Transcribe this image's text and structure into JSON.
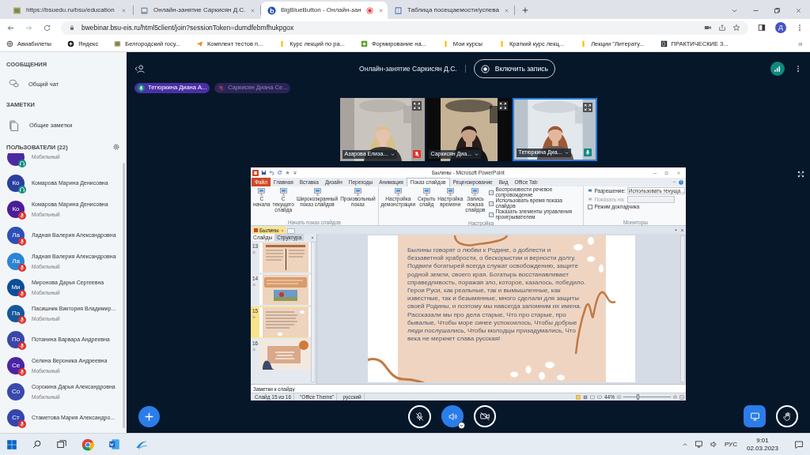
{
  "browser": {
    "tabs": [
      {
        "title": "https://bsuedu.ru/bsu/education",
        "kind": "site",
        "selected": false,
        "recording": false
      },
      {
        "title": "Онлайн-занятие Саркисян Д.С.",
        "kind": "page",
        "selected": false,
        "recording": false
      },
      {
        "title": "BigBlueButton - Онлайн-зан",
        "kind": "conference",
        "selected": true,
        "recording": true
      },
      {
        "title": "Таблица посещаемости/успева",
        "kind": "sheet",
        "selected": false,
        "recording": false
      }
    ],
    "url": "bwebinar.bsu-eis.ru/html5client/join?sessionToken=dumdfebmfhukpgox",
    "profile": "Д",
    "bookmarks": [
      {
        "label": "Авиабилеты",
        "kind": "globe"
      },
      {
        "label": "Яндекс",
        "kind": "circle"
      },
      {
        "label": "Белгородский госу...",
        "kind": "site"
      },
      {
        "label": "Комплект тестов п...",
        "kind": "plane"
      },
      {
        "label": "Курс лекций по ра...",
        "kind": "bar"
      },
      {
        "label": "Формирование на...",
        "kind": "green"
      },
      {
        "label": "Мои курсы",
        "kind": "bar"
      },
      {
        "label": "Краткий курс лекц...",
        "kind": "bar"
      },
      {
        "label": "Лекции \"Литерату...",
        "kind": "bar"
      },
      {
        "label": "ПРАКТИЧЕСКИЕ З...",
        "kind": "dark"
      }
    ]
  },
  "sidebar": {
    "messages_heading": "СООБЩЕНИЯ",
    "chat": "Общий чат",
    "notes_heading": "ЗАМЕТКИ",
    "notes": "Общие заметки",
    "users_heading": "ПОЛЬЗОВАТЕЛИ (22)",
    "users": [
      {
        "subtitle": "Мобильный",
        "color": "#4b2aa0",
        "kind": "listener"
      },
      {
        "initials": "Ко",
        "name": "Комарова Марина Денисовна",
        "color": "#2a3f9f",
        "kind": "listener"
      },
      {
        "initials": "Ко",
        "name": "Комарова Марина Денисовна",
        "subtitle": "Мобильный",
        "color": "#4a1e98",
        "kind": "muted"
      },
      {
        "initials": "Ла",
        "name": "Ладная Валерия Александровна",
        "color": "#2d4fb8",
        "kind": "muted"
      },
      {
        "initials": "Ла",
        "name": "Ладная Валерия Александровна",
        "subtitle": "Мобильный",
        "color": "#2b84d6",
        "kind": "muted"
      },
      {
        "initials": "Ми",
        "name": "Миронова Дарья Сергеевна",
        "subtitle": "Мобильный",
        "color": "#0d4d99",
        "kind": "muted"
      },
      {
        "initials": "Па",
        "name": "Пасишник Виктория Владимир...",
        "subtitle": "Мобильный",
        "color": "#15579c",
        "kind": "muted"
      },
      {
        "initials": "По",
        "name": "Потанина Варвара Андреевна",
        "color": "#3a46a8",
        "kind": "muted"
      },
      {
        "initials": "Се",
        "name": "Селина Вероника Андреевна",
        "subtitle": "Мобильный",
        "color": "#4a24a4",
        "kind": "muted"
      },
      {
        "initials": "Со",
        "name": "Сорокина Дарья Александровна",
        "subtitle": "Мобильный",
        "color": "#3949ab",
        "kind": "plain"
      },
      {
        "initials": "Ст",
        "name": "Стаметова Мария Александро...",
        "color": "#3446ae",
        "kind": "muted"
      }
    ]
  },
  "header": {
    "title": "Онлайн-занятие Саркисян Д.С.",
    "record_button": "Включить запись"
  },
  "talkers": [
    {
      "name": "Тетюркина Диана А...",
      "muted": false
    },
    {
      "name": "Саркисян Диана Се...",
      "muted": true
    }
  ],
  "videos": [
    {
      "name": "Азарова Елиза...",
      "kind": "muted",
      "selected": false
    },
    {
      "name": "Саркисян Диа...",
      "kind": "plain",
      "selected": false
    },
    {
      "name": "Тетюркина Диа...",
      "kind": "talking",
      "selected": true
    }
  ],
  "presentation": {
    "title": "Былины - Microsoft PowerPoint",
    "ribbon_tabs": [
      {
        "label": "Файл",
        "kind": "file",
        "selected": false
      },
      {
        "label": "Главная",
        "kind": "tab",
        "selected": false
      },
      {
        "label": "Вставка",
        "kind": "tab",
        "selected": false
      },
      {
        "label": "Дизайн",
        "kind": "tab",
        "selected": false
      },
      {
        "label": "Переходы",
        "kind": "tab",
        "selected": false
      },
      {
        "label": "Анимация",
        "kind": "tab",
        "selected": false
      },
      {
        "label": "Показ слайдов",
        "kind": "tab",
        "selected": true
      },
      {
        "label": "Рецензирование",
        "kind": "tab",
        "selected": false
      },
      {
        "label": "Вид",
        "kind": "tab",
        "selected": false
      },
      {
        "label": "Office Tab",
        "kind": "tab",
        "selected": false
      }
    ],
    "groups": [
      {
        "label": "Начать показ слайдов",
        "buttons": [
          "С начала",
          "С текущего слайда",
          "Широкоэкранный показ слайдов",
          "Произвольный показ"
        ]
      },
      {
        "label": "Настройка",
        "buttons": [
          "Настройка демонстрации",
          "Скрыть слайд",
          "Настройка времени",
          "Запись показа слайдов"
        ],
        "checkboxes": [
          {
            "label": "Воспроизвести речевое сопровождение",
            "checked": true
          },
          {
            "label": "Использовать время показа слайдов",
            "checked": true
          },
          {
            "label": "Показать элементы управления проигрывателем",
            "checked": true
          }
        ]
      },
      {
        "label": "Мониторы",
        "fields": [
          {
            "label": "Разрешение:",
            "value": "Использовать текуща...",
            "disabled": false
          },
          {
            "label": "Показать на:",
            "disabled": true
          }
        ],
        "checkboxes": [
          {
            "label": "Режим докладчика",
            "checked": false
          }
        ]
      }
    ],
    "document_tab": "Былины",
    "pane_tabs": [
      {
        "label": "Слайды",
        "selected": true
      },
      {
        "label": "Структура",
        "selected": false
      }
    ],
    "thumbnails": [
      {
        "number": "13",
        "kind": "columns",
        "selected": false
      },
      {
        "number": "14",
        "selected": false
      },
      {
        "number": "15",
        "kind": "text",
        "selected": true
      },
      {
        "number": "16",
        "kind": "closing",
        "selected": false
      }
    ],
    "slide_text": "Былины говорят о любви к Родине, о доблести и беззаветной храбрости, о бескорыстии и верности долгу. Подвиги богатырей всегда служат освобождению, защите родной земли, своего края. Богатырь восстанавливает справедливость, поражая зло, которое, казалось, победило. Герои Руси, как реальные, так и вымышленные, как известные, так и безымянные, много сделали для защиты своей Родины, и поэтому мы навсегда запомним их имена. Рассказали мы про дела старые, Что про старые, про бывалые, Чтобы море синее успокоилось, Чтобы добрые люди послушались, Чтобы молодцы призадумались, Что века не меркнет слава русская!",
    "notes": {
      "placeholder": "Заметки к слайду"
    },
    "status": [
      "Слайд 15 из 16",
      "\"Office Theme\"",
      "русский"
    ],
    "zoom": "44%",
    "zoom_slider": {
      "level": 0.3
    }
  },
  "controls": {
    "microphone_muted": true,
    "audio_on": true,
    "camera_on": false
  },
  "taskbar": {
    "language": "РУС",
    "time": "9:01",
    "date": "02.03.2023"
  }
}
